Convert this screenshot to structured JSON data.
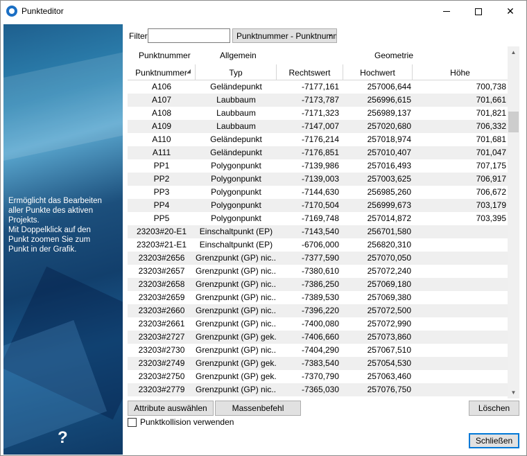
{
  "window": {
    "title": "Punkteditor",
    "close_glyph": "✕"
  },
  "left_panel": {
    "description": "Ermöglicht das Bearbeiten\naller Punkte des aktiven\nProjekts.\nMit Doppelklick auf den\nPunkt zoomen Sie zum\nPunkt in der Grafik.",
    "help_label": "?"
  },
  "filter": {
    "label": "Filter",
    "value": "",
    "select_value": "Punktnummer - Punktnummer"
  },
  "grid": {
    "groups": [
      "Punktnummer",
      "Allgemein",
      "Geometrie"
    ],
    "columns": [
      "Punktnummer",
      "Typ",
      "Rechtswert",
      "Hochwert",
      "Höhe"
    ],
    "rows": [
      [
        "A106",
        "Geländepunkt",
        "-7177,161",
        "257006,644",
        "700,738"
      ],
      [
        "A107",
        "Laubbaum",
        "-7173,787",
        "256996,615",
        "701,661"
      ],
      [
        "A108",
        "Laubbaum",
        "-7171,323",
        "256989,137",
        "701,821"
      ],
      [
        "A109",
        "Laubbaum",
        "-7147,007",
        "257020,680",
        "706,332"
      ],
      [
        "A110",
        "Geländepunkt",
        "-7176,214",
        "257018,974",
        "701,681"
      ],
      [
        "A111",
        "Geländepunkt",
        "-7176,851",
        "257010,407",
        "701,047"
      ],
      [
        "PP1",
        "Polygonpunkt",
        "-7139,986",
        "257016,493",
        "707,175"
      ],
      [
        "PP2",
        "Polygonpunkt",
        "-7139,003",
        "257003,625",
        "706,917"
      ],
      [
        "PP3",
        "Polygonpunkt",
        "-7144,630",
        "256985,260",
        "706,672"
      ],
      [
        "PP4",
        "Polygonpunkt",
        "-7170,504",
        "256999,673",
        "703,179"
      ],
      [
        "PP5",
        "Polygonpunkt",
        "-7169,748",
        "257014,872",
        "703,395"
      ],
      [
        "23203#20-E1",
        "Einschaltpunkt (EP)",
        "-7143,540",
        "256701,580",
        ""
      ],
      [
        "23203#21-E1",
        "Einschaltpunkt (EP)",
        "-6706,000",
        "256820,310",
        ""
      ],
      [
        "23203#2656",
        "Grenzpunkt (GP) nic...",
        "-7377,590",
        "257070,050",
        ""
      ],
      [
        "23203#2657",
        "Grenzpunkt (GP) nic...",
        "-7380,610",
        "257072,240",
        ""
      ],
      [
        "23203#2658",
        "Grenzpunkt (GP) nic...",
        "-7386,250",
        "257069,180",
        ""
      ],
      [
        "23203#2659",
        "Grenzpunkt (GP) nic...",
        "-7389,530",
        "257069,380",
        ""
      ],
      [
        "23203#2660",
        "Grenzpunkt (GP) nic...",
        "-7396,220",
        "257072,500",
        ""
      ],
      [
        "23203#2661",
        "Grenzpunkt (GP) nic...",
        "-7400,080",
        "257072,990",
        ""
      ],
      [
        "23203#2727",
        "Grenzpunkt (GP) gek...",
        "-7406,660",
        "257073,860",
        ""
      ],
      [
        "23203#2730",
        "Grenzpunkt (GP) nic...",
        "-7404,290",
        "257067,510",
        ""
      ],
      [
        "23203#2749",
        "Grenzpunkt (GP) gek...",
        "-7383,540",
        "257054,530",
        ""
      ],
      [
        "23203#2750",
        "Grenzpunkt (GP) gek...",
        "-7370,790",
        "257063,460",
        ""
      ],
      [
        "23203#2779",
        "Grenzpunkt (GP) nic...",
        "-7365,030",
        "257076,750",
        ""
      ]
    ]
  },
  "buttons": {
    "attributes": "Attribute auswählen",
    "mass_command": "Massenbefehl",
    "delete": "Löschen",
    "close": "Schließen"
  },
  "checkbox": {
    "label": "Punktkollision verwenden",
    "checked": false
  }
}
